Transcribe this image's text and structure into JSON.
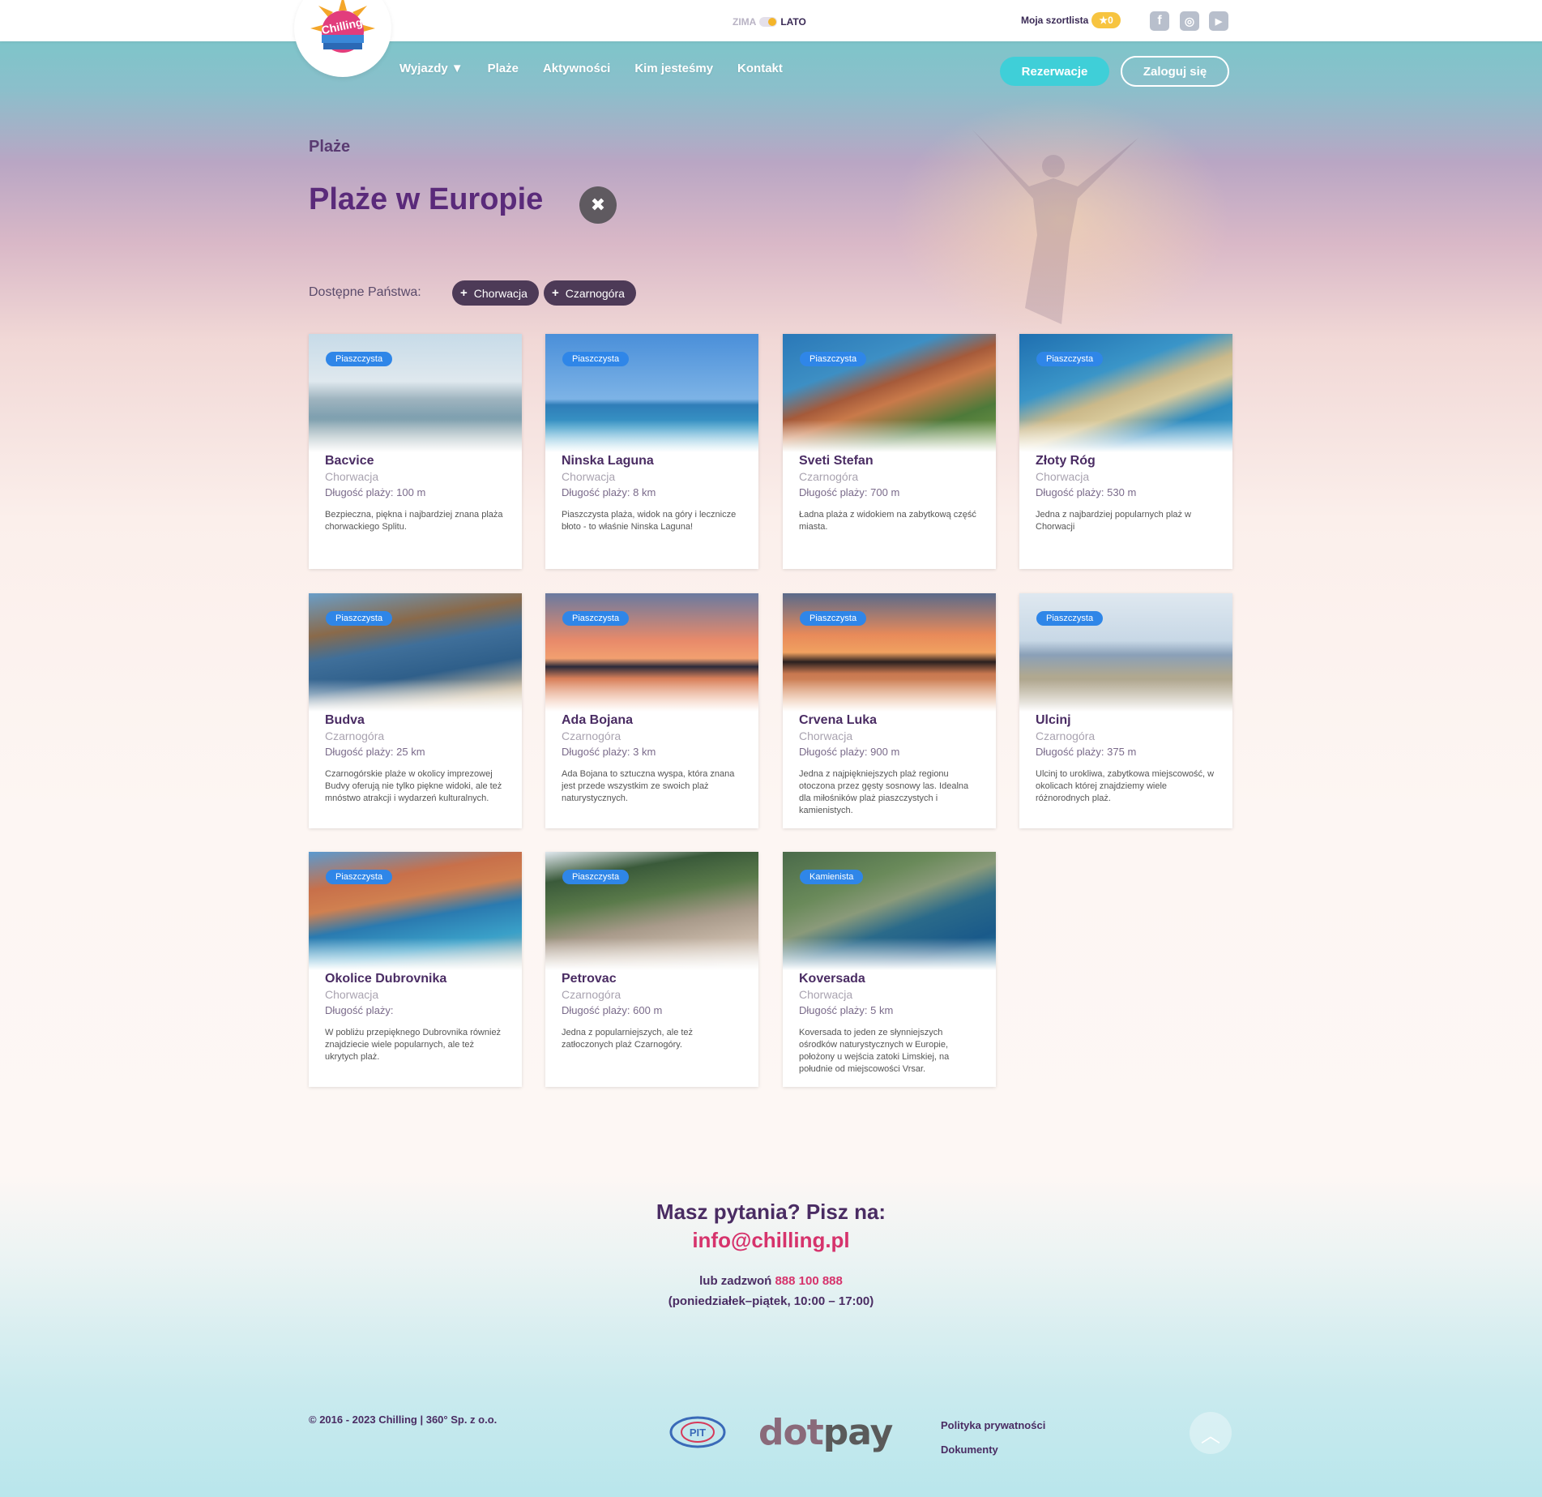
{
  "header": {
    "season_off": "ZIMA",
    "season_on": "LATO",
    "shortlist_label": "Moja szortlista",
    "shortlist_count": "★0"
  },
  "nav": {
    "items": [
      {
        "label": "Wyjazdy"
      },
      {
        "label": "Plaże"
      },
      {
        "label": "Aktywności"
      },
      {
        "label": "Kim jesteśmy"
      },
      {
        "label": "Kontakt"
      }
    ],
    "reserve": "Rezerwacje",
    "login": "Zaloguj się"
  },
  "social": {
    "facebook": "f",
    "instagram": "◎",
    "youtube": "▶"
  },
  "page": {
    "breadcrumb": "Plaże",
    "title": "Plaże w Europie",
    "filter_label": "Dostępne Państwa:",
    "chips": [
      "Chorwacja",
      "Czarnogóra"
    ]
  },
  "cards": [
    {
      "tag": "Piaszczysta",
      "name": "Bacvice",
      "country": "Chorwacja",
      "length": "Długość plaży: 100 m",
      "desc": "Bezpieczna, piękna i najbardziej znana plaża chorwackiego Splitu."
    },
    {
      "tag": "Piaszczysta",
      "name": "Ninska Laguna",
      "country": "Chorwacja",
      "length": "Długość plaży: 8 km",
      "desc": "Piaszczysta plaża, widok na góry i lecznicze błoto - to właśnie Ninska Laguna!"
    },
    {
      "tag": "Piaszczysta",
      "name": "Sveti Stefan",
      "country": "Czarnogóra",
      "length": "Długość plaży: 700 m",
      "desc": "Ładna plaża z widokiem na zabytkową część miasta."
    },
    {
      "tag": "Piaszczysta",
      "name": "Złoty Róg",
      "country": "Chorwacja",
      "length": "Długość plaży: 530 m",
      "desc": "Jedna z najbardziej popularnych plaż w Chorwacji"
    },
    {
      "tag": "Piaszczysta",
      "name": "Budva",
      "country": "Czarnogóra",
      "length": "Długość plaży: 25 km",
      "desc": "Czarnogórskie plaże w okolicy imprezowej Budvy oferują nie tylko piękne widoki, ale też mnóstwo atrakcji i wydarzeń kulturalnych."
    },
    {
      "tag": "Piaszczysta",
      "name": "Ada Bojana",
      "country": "Czarnogóra",
      "length": "Długość plaży: 3 km",
      "desc": "Ada Bojana to sztuczna wyspa, która znana jest przede wszystkim ze swoich plaż naturystycznych."
    },
    {
      "tag": "Piaszczysta",
      "name": "Crvena Luka",
      "country": "Chorwacja",
      "length": "Długość plaży: 900 m",
      "desc": "Jedna z najpiękniejszych plaż regionu otoczona przez gęsty sosnowy las. Idealna dla miłośników plaż piaszczystych i kamienistych."
    },
    {
      "tag": "Piaszczysta",
      "name": "Ulcinj",
      "country": "Czarnogóra",
      "length": "Długość plaży: 375 m",
      "desc": "Ulcinj to urokliwa, zabytkowa miejscowość, w okolicach której znajdziemy wiele różnorodnych plaż."
    },
    {
      "tag": "Piaszczysta",
      "name": "Okolice Dubrovnika",
      "country": "Chorwacja",
      "length": "Długość plaży:",
      "desc": "W pobliżu przepięknego Dubrovnika również znajdziecie wiele popularnych, ale też ukrytych plaż."
    },
    {
      "tag": "Piaszczysta",
      "name": "Petrovac",
      "country": "Czarnogóra",
      "length": "Długość plaży: 600 m",
      "desc": "Jedna z popularniejszych, ale też zatłoczonych plaż Czarnogóry."
    },
    {
      "tag": "Kamienista",
      "name": "Koversada",
      "country": "Chorwacja",
      "length": "Długość plaży: 5 km",
      "desc": "Koversada to jeden ze słynniejszych ośrodków naturystycznych w Europie, położony u wejścia zatoki Limskiej, na południe od miejscowości Vrsar."
    }
  ],
  "contact": {
    "question": "Masz pytania? Pisz na:",
    "email": "info@chilling.pl",
    "call_prefix": "lub zadzwoń ",
    "phone": "888 100 888",
    "hours": "(poniedziałek–piątek, 10:00 – 17:00)"
  },
  "footer": {
    "copyright": "© 2016 - 2023 Chilling | 360° Sp. z o.o.",
    "pit": "PIT",
    "dotpay_dot": "dot",
    "dotpay_pay": "pay",
    "privacy": "Polityka prywatności",
    "documents": "Dokumenty",
    "logo_text": "Chilling"
  }
}
